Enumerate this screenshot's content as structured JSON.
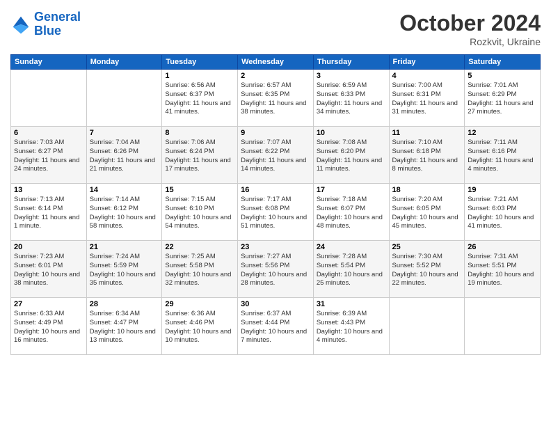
{
  "logo": {
    "line1": "General",
    "line2": "Blue"
  },
  "header": {
    "month": "October 2024",
    "location": "Rozkvit, Ukraine"
  },
  "weekdays": [
    "Sunday",
    "Monday",
    "Tuesday",
    "Wednesday",
    "Thursday",
    "Friday",
    "Saturday"
  ],
  "weeks": [
    [
      {
        "day": "",
        "info": ""
      },
      {
        "day": "",
        "info": ""
      },
      {
        "day": "1",
        "info": "Sunrise: 6:56 AM\nSunset: 6:37 PM\nDaylight: 11 hours and 41 minutes."
      },
      {
        "day": "2",
        "info": "Sunrise: 6:57 AM\nSunset: 6:35 PM\nDaylight: 11 hours and 38 minutes."
      },
      {
        "day": "3",
        "info": "Sunrise: 6:59 AM\nSunset: 6:33 PM\nDaylight: 11 hours and 34 minutes."
      },
      {
        "day": "4",
        "info": "Sunrise: 7:00 AM\nSunset: 6:31 PM\nDaylight: 11 hours and 31 minutes."
      },
      {
        "day": "5",
        "info": "Sunrise: 7:01 AM\nSunset: 6:29 PM\nDaylight: 11 hours and 27 minutes."
      }
    ],
    [
      {
        "day": "6",
        "info": "Sunrise: 7:03 AM\nSunset: 6:27 PM\nDaylight: 11 hours and 24 minutes."
      },
      {
        "day": "7",
        "info": "Sunrise: 7:04 AM\nSunset: 6:26 PM\nDaylight: 11 hours and 21 minutes."
      },
      {
        "day": "8",
        "info": "Sunrise: 7:06 AM\nSunset: 6:24 PM\nDaylight: 11 hours and 17 minutes."
      },
      {
        "day": "9",
        "info": "Sunrise: 7:07 AM\nSunset: 6:22 PM\nDaylight: 11 hours and 14 minutes."
      },
      {
        "day": "10",
        "info": "Sunrise: 7:08 AM\nSunset: 6:20 PM\nDaylight: 11 hours and 11 minutes."
      },
      {
        "day": "11",
        "info": "Sunrise: 7:10 AM\nSunset: 6:18 PM\nDaylight: 11 hours and 8 minutes."
      },
      {
        "day": "12",
        "info": "Sunrise: 7:11 AM\nSunset: 6:16 PM\nDaylight: 11 hours and 4 minutes."
      }
    ],
    [
      {
        "day": "13",
        "info": "Sunrise: 7:13 AM\nSunset: 6:14 PM\nDaylight: 11 hours and 1 minute."
      },
      {
        "day": "14",
        "info": "Sunrise: 7:14 AM\nSunset: 6:12 PM\nDaylight: 10 hours and 58 minutes."
      },
      {
        "day": "15",
        "info": "Sunrise: 7:15 AM\nSunset: 6:10 PM\nDaylight: 10 hours and 54 minutes."
      },
      {
        "day": "16",
        "info": "Sunrise: 7:17 AM\nSunset: 6:08 PM\nDaylight: 10 hours and 51 minutes."
      },
      {
        "day": "17",
        "info": "Sunrise: 7:18 AM\nSunset: 6:07 PM\nDaylight: 10 hours and 48 minutes."
      },
      {
        "day": "18",
        "info": "Sunrise: 7:20 AM\nSunset: 6:05 PM\nDaylight: 10 hours and 45 minutes."
      },
      {
        "day": "19",
        "info": "Sunrise: 7:21 AM\nSunset: 6:03 PM\nDaylight: 10 hours and 41 minutes."
      }
    ],
    [
      {
        "day": "20",
        "info": "Sunrise: 7:23 AM\nSunset: 6:01 PM\nDaylight: 10 hours and 38 minutes."
      },
      {
        "day": "21",
        "info": "Sunrise: 7:24 AM\nSunset: 5:59 PM\nDaylight: 10 hours and 35 minutes."
      },
      {
        "day": "22",
        "info": "Sunrise: 7:25 AM\nSunset: 5:58 PM\nDaylight: 10 hours and 32 minutes."
      },
      {
        "day": "23",
        "info": "Sunrise: 7:27 AM\nSunset: 5:56 PM\nDaylight: 10 hours and 28 minutes."
      },
      {
        "day": "24",
        "info": "Sunrise: 7:28 AM\nSunset: 5:54 PM\nDaylight: 10 hours and 25 minutes."
      },
      {
        "day": "25",
        "info": "Sunrise: 7:30 AM\nSunset: 5:52 PM\nDaylight: 10 hours and 22 minutes."
      },
      {
        "day": "26",
        "info": "Sunrise: 7:31 AM\nSunset: 5:51 PM\nDaylight: 10 hours and 19 minutes."
      }
    ],
    [
      {
        "day": "27",
        "info": "Sunrise: 6:33 AM\nSunset: 4:49 PM\nDaylight: 10 hours and 16 minutes."
      },
      {
        "day": "28",
        "info": "Sunrise: 6:34 AM\nSunset: 4:47 PM\nDaylight: 10 hours and 13 minutes."
      },
      {
        "day": "29",
        "info": "Sunrise: 6:36 AM\nSunset: 4:46 PM\nDaylight: 10 hours and 10 minutes."
      },
      {
        "day": "30",
        "info": "Sunrise: 6:37 AM\nSunset: 4:44 PM\nDaylight: 10 hours and 7 minutes."
      },
      {
        "day": "31",
        "info": "Sunrise: 6:39 AM\nSunset: 4:43 PM\nDaylight: 10 hours and 4 minutes."
      },
      {
        "day": "",
        "info": ""
      },
      {
        "day": "",
        "info": ""
      }
    ]
  ]
}
